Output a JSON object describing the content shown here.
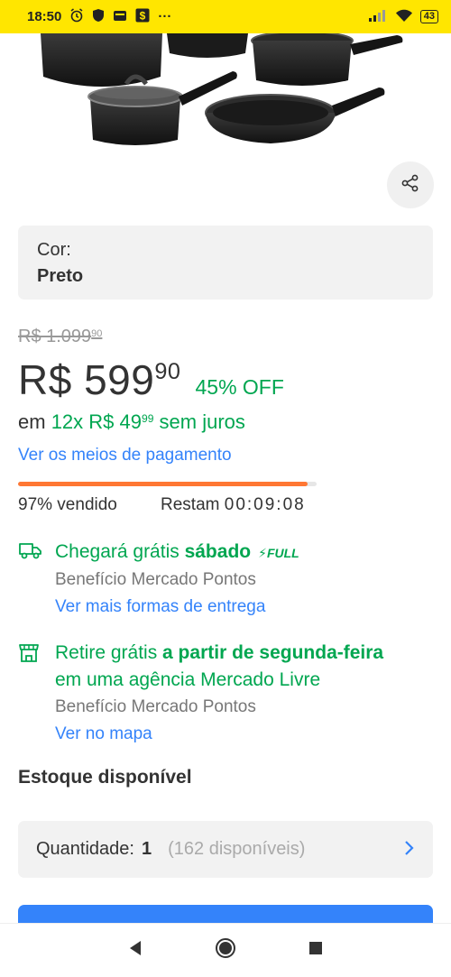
{
  "status_bar": {
    "time": "18:50",
    "icons": [
      "alarm-icon",
      "shield-icon",
      "wallet-icon",
      "dollar-app-icon",
      "more-dots-icon"
    ],
    "more": "···",
    "battery": "43"
  },
  "color_selector": {
    "label": "Cor:",
    "value": "Preto"
  },
  "pricing": {
    "old_price_main": "R$ 1.099",
    "old_price_cents": "90",
    "price_main": "R$ 599",
    "price_cents": "90",
    "discount": "45% OFF",
    "installment_prefix": "em ",
    "installment_main": "12x R$ 49",
    "installment_cents": "99",
    "installment_suffix": " sem juros",
    "payment_link": "Ver os meios de pagamento"
  },
  "deal": {
    "sold_fraction": 0.97,
    "sold_label": "97% vendido",
    "remain_label": "Restam",
    "timer": "00:09:08",
    "accent": "#ff7733"
  },
  "shipping": {
    "line_prefix": "Chegará grátis ",
    "day": "sábado",
    "badge": "FULL",
    "benefit": "Benefício Mercado Pontos",
    "link": "Ver mais formas de entrega"
  },
  "pickup": {
    "line1_prefix": "Retire grátis ",
    "line1_bold": "a partir de segunda-feira",
    "line2": "em uma agência Mercado Livre",
    "benefit": "Benefício Mercado Pontos",
    "link": "Ver no mapa"
  },
  "stock": {
    "title": "Estoque disponível",
    "quantity_label": "Quantidade:",
    "quantity_value": "1",
    "available": "(162 disponíveis)"
  },
  "colors": {
    "brand_yellow": "#ffe600",
    "green": "#00a650",
    "link_blue": "#3483fa"
  }
}
